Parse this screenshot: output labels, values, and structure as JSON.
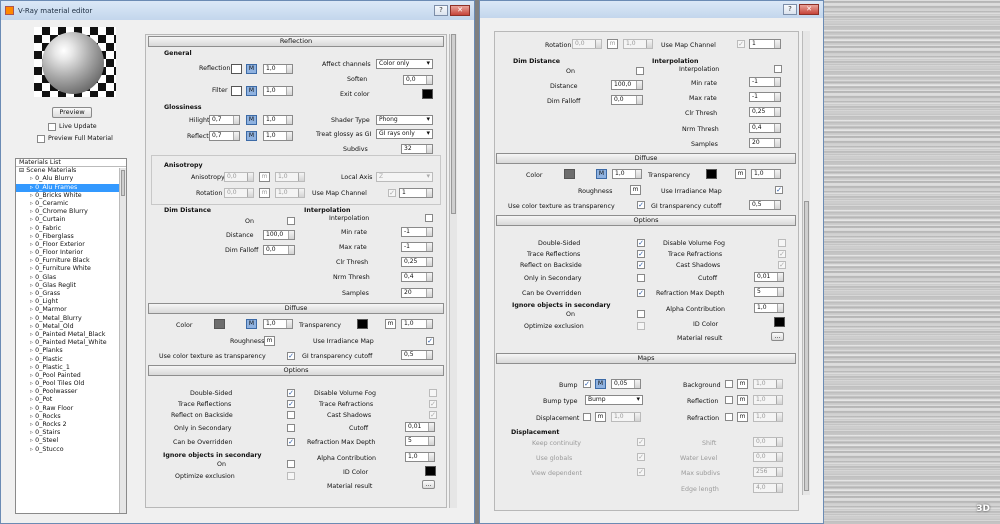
{
  "window": {
    "title": "V-Ray material editor",
    "help": "?",
    "close": "✕"
  },
  "preview": {
    "button": "Preview",
    "live_update": "Live Update",
    "preview_full": "Preview Full Material"
  },
  "materials": {
    "header": "Materials List",
    "root": "Scene Materials",
    "items": [
      "0_Alu Blurry",
      "0_Alu Frames",
      "0_Bricks White",
      "0_Ceramic",
      "0_Chrome Blurry",
      "0_Curtain",
      "0_Fabric",
      "0_Fiberglass",
      "0_Floor Exterior",
      "0_Floor Interior",
      "0_Furniture Black",
      "0_Furniture White",
      "0_Glas",
      "0_Glas Reglit",
      "0_Grass",
      "0_Light",
      "0_Marmor",
      "0_Metal_Blurry",
      "0_Metal_Old",
      "0_Painted Metal_Black",
      "0_Painted Metal_White",
      "0_Planks",
      "0_Plastic",
      "0_Plastic_1",
      "0_Pool Painted",
      "0_Pool Tiles Old",
      "0_Poolwasser",
      "0_Pot",
      "0_Raw Floor",
      "0_Rocks",
      "0_Rocks 2",
      "0_Stairs",
      "0_Steel",
      "0_Stucco"
    ],
    "selected": "0_Alu Frames"
  },
  "reflection": {
    "header": "Reflection",
    "general": "General",
    "reflection": "Reflection",
    "filter": "Filter",
    "affect_channels": "Affect channels",
    "affect_value": "Color only",
    "soften": "Soften",
    "soften_value": "0,0",
    "exit_color": "Exit color",
    "m": "M",
    "one": "1,0",
    "glossiness": "Glossiness",
    "hilight": "Hilight",
    "reflect": "Reflect",
    "gloss_value": "0,7",
    "shader_type": "Shader Type",
    "shader_value": "Phong",
    "treat_glossy": "Treat glossy as GI",
    "treat_value": "GI rays only",
    "subdivs": "Subdivs",
    "subdivs_value": "32",
    "anisotropy": "Anisotropy",
    "aniso_label": "Anisotropy",
    "rotation": "Rotation",
    "zero": "0,0",
    "local_axis": "Local Axis",
    "local_value": "Z",
    "use_map_channel": "Use Map Channel",
    "map_channel": "1",
    "dim_distance": "Dim Distance",
    "on": "On",
    "distance": "Distance",
    "distance_value": "100,0",
    "dim_falloff": "Dim Falloff",
    "falloff_value": "0,0",
    "interpolation": "Interpolation",
    "interp_label": "Interpolation",
    "min_rate": "Min rate",
    "min_value": "-1",
    "max_rate": "Max rate",
    "max_value": "-1",
    "clr_thresh": "Clr Thresh",
    "clr_value": "0,25",
    "nrm_thresh": "Nrm Thresh",
    "nrm_value": "0,4",
    "samples": "Samples",
    "samples_value": "20"
  },
  "diffuse": {
    "header": "Diffuse",
    "color": "Color",
    "m": "M",
    "m_low": "m",
    "one": "1,0",
    "transparency": "Transparency",
    "roughness": "Roughness",
    "use_irradiance": "Use Irradiance Map",
    "use_color_tex": "Use color texture as transparency",
    "gi_cutoff": "GI transparency cutoff",
    "gi_value": "0,5"
  },
  "options": {
    "header": "Options",
    "double_sided": "Double-Sided",
    "trace_reflections": "Trace Reflections",
    "reflect_backside": "Reflect on Backside",
    "only_secondary": "Only in Secondary",
    "can_override": "Can be Overridden",
    "ignore_secondary": "Ignore objects in secondary",
    "on": "On",
    "optimize_exclusion": "Optimize exclusion",
    "disable_fog": "Disable Volume Fog",
    "trace_refractions": "Trace Refractions",
    "cast_shadows": "Cast Shadows",
    "cutoff": "Cutoff",
    "cutoff_value": "0,01",
    "refraction_depth": "Refraction Max Depth",
    "depth_value": "5",
    "alpha": "Alpha Contribution",
    "alpha_value": "1,0",
    "id_color": "ID Color",
    "material_result": "Material result",
    "dots": "..."
  },
  "maps": {
    "header": "Maps",
    "bump": "Bump",
    "bump_value": "0,05",
    "bump_type": "Bump type",
    "bump_type_value": "Bump",
    "displacement": "Displacement",
    "background": "Background",
    "reflection": "Reflection",
    "refraction": "Refraction",
    "m": "M",
    "m_low": "m",
    "one": "1,0",
    "disp_group": "Displacement",
    "keep_continuity": "Keep continuity",
    "use_globals": "Use globals",
    "view_dependent": "View dependent",
    "shift": "Shift",
    "shift_value": "0,0",
    "water_level": "Water Level",
    "water_value": "0,0",
    "max_subdivs": "Max subdivs",
    "subdivs_value": "256",
    "edge_length": "Edge length",
    "edge_value": "4,0"
  },
  "watermark": "3D"
}
